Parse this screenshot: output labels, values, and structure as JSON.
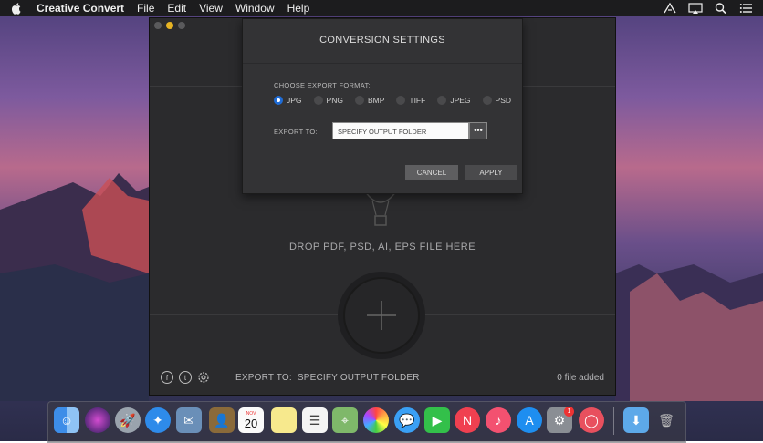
{
  "menubar": {
    "app_name": "Creative Convert",
    "menus": [
      "File",
      "Edit",
      "View",
      "Window",
      "Help"
    ]
  },
  "window": {
    "drop_text": "DROP PDF, PSD, AI, EPS FILE HERE",
    "footer": {
      "export_label": "EXPORT TO:",
      "export_value": "SPECIFY OUTPUT FOLDER",
      "file_count": "0 file added"
    },
    "social": [
      "facebook-icon",
      "twitter-icon",
      "settings-gear-icon"
    ]
  },
  "dialog": {
    "title": "CONVERSION SETTINGS",
    "choose_label": "CHOOSE EXPORT FORMAT:",
    "formats": [
      "JPG",
      "PNG",
      "BMP",
      "TIFF",
      "JPEG",
      "PSD"
    ],
    "selected_format": "JPG",
    "export_label": "EXPORT TO:",
    "folder_placeholder": "SPECIFY OUTPUT FOLDER",
    "browse_label": "•••",
    "cancel_label": "CANCEL",
    "apply_label": "APPLY"
  },
  "dock": {
    "calendar_month": "NOV",
    "calendar_day": "20",
    "badge_count": "1"
  },
  "colors": {
    "accent": "#1f6cd6",
    "window_bg": "#2b2b2d",
    "dialog_bg": "#333335"
  }
}
